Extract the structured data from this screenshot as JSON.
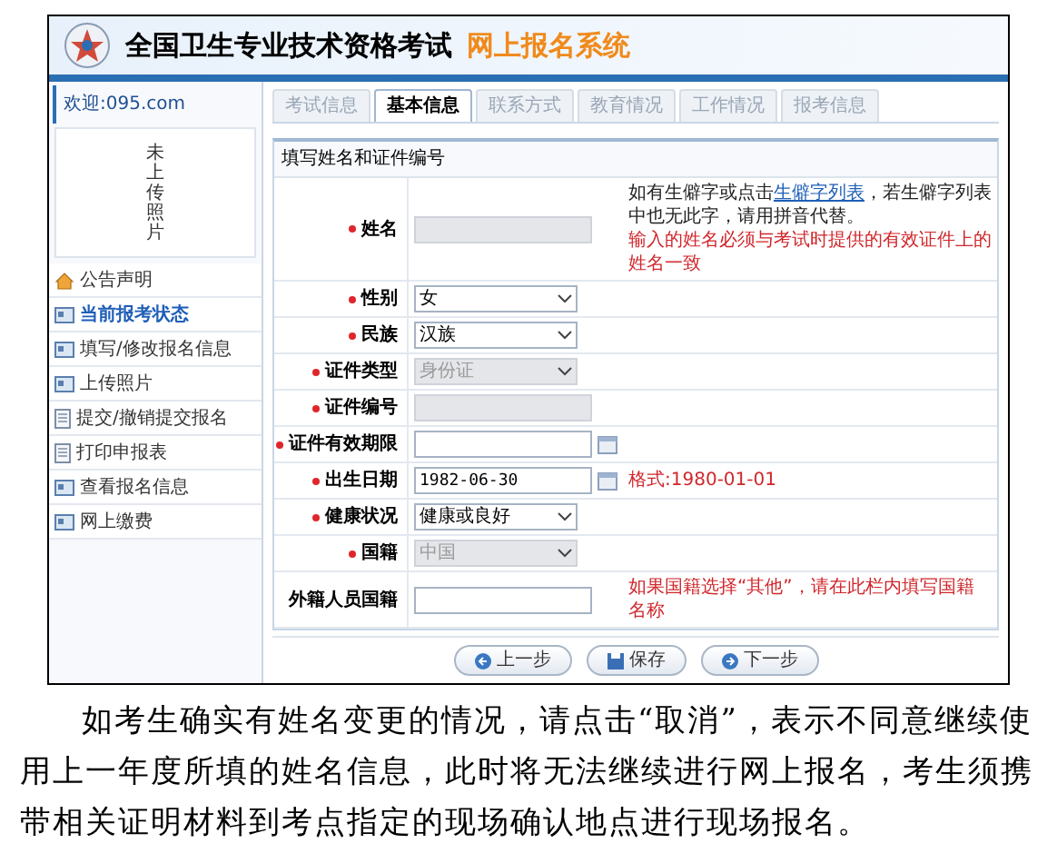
{
  "header": {
    "title": "全国卫生专业技术资格考试",
    "subtitle": "网上报名系统"
  },
  "sidebar": {
    "welcome": "欢迎:095.com",
    "photo_placeholder": "未上传照片",
    "menu": [
      {
        "label": "公告声明",
        "kind": "home",
        "selected": false
      },
      {
        "label": "当前报考状态",
        "kind": "card",
        "selected": true
      },
      {
        "label": "填写/修改报名信息",
        "kind": "card",
        "selected": false
      },
      {
        "label": "上传照片",
        "kind": "card",
        "selected": false
      },
      {
        "label": "提交/撤销提交报名",
        "kind": "page",
        "selected": false
      },
      {
        "label": "打印申报表",
        "kind": "page",
        "selected": false
      },
      {
        "label": "查看报名信息",
        "kind": "card",
        "selected": false
      },
      {
        "label": "网上缴费",
        "kind": "card",
        "selected": false
      }
    ]
  },
  "tabs": [
    {
      "label": "考试信息",
      "selected": false
    },
    {
      "label": "基本信息",
      "selected": true
    },
    {
      "label": "联系方式",
      "selected": false
    },
    {
      "label": "教育情况",
      "selected": false
    },
    {
      "label": "工作情况",
      "selected": false
    },
    {
      "label": "报考信息",
      "selected": false
    }
  ],
  "form": {
    "section_title": "填写姓名和证件编号",
    "rows": [
      {
        "label": "姓名",
        "required": true,
        "kind": "input",
        "disabled": true,
        "notes": [
          {
            "kind": "info",
            "parts": [
              {
                "text": "如有生僻字或点击"
              },
              {
                "text": "生僻字列表",
                "link": true
              },
              {
                "text": "，若生僻字列表中也无此字，请用拼音代替。"
              }
            ]
          },
          {
            "kind": "warning",
            "text": "输入的姓名必须与考试时提供的有效证件上的姓名一致"
          }
        ]
      },
      {
        "label": "性别",
        "required": true,
        "kind": "select",
        "value": "女",
        "disabled": false
      },
      {
        "label": "民族",
        "required": true,
        "kind": "select",
        "value": "汉族",
        "disabled": false
      },
      {
        "label": "证件类型",
        "required": true,
        "kind": "select",
        "value": "身份证",
        "disabled": true
      },
      {
        "label": "证件编号",
        "required": true,
        "kind": "input",
        "disabled": true
      },
      {
        "label": "证件有效期限",
        "required": true,
        "kind": "date",
        "disabled": false
      },
      {
        "label": "出生日期",
        "required": true,
        "kind": "date",
        "value": "1982-06-30",
        "disabled": false,
        "notes": [
          {
            "kind": "warning",
            "text": "格式:1980-01-01"
          }
        ]
      },
      {
        "label": "健康状况",
        "required": true,
        "kind": "select",
        "value": "健康或良好",
        "disabled": false
      },
      {
        "label": "国籍",
        "required": true,
        "kind": "select",
        "value": "中国",
        "disabled": true
      },
      {
        "label": "外籍人员国籍",
        "required": false,
        "kind": "input",
        "disabled": false,
        "notes": [
          {
            "kind": "warning",
            "text": "如果国籍选择“其他”，请在此栏内填写国籍名称"
          }
        ]
      }
    ]
  },
  "buttons": [
    {
      "label": "上一步",
      "kind": "back"
    },
    {
      "label": "保存",
      "kind": "save"
    },
    {
      "label": "下一步",
      "kind": "next"
    }
  ],
  "paragraph": "如考生确实有姓名变更的情况，请点击“取消”，表示不同意继续使用上一年度所填的姓名信息，此时将无法继续进行网上报名，考生须携带相关证明材料到考点指定的现场确认地点进行现场报名。"
}
